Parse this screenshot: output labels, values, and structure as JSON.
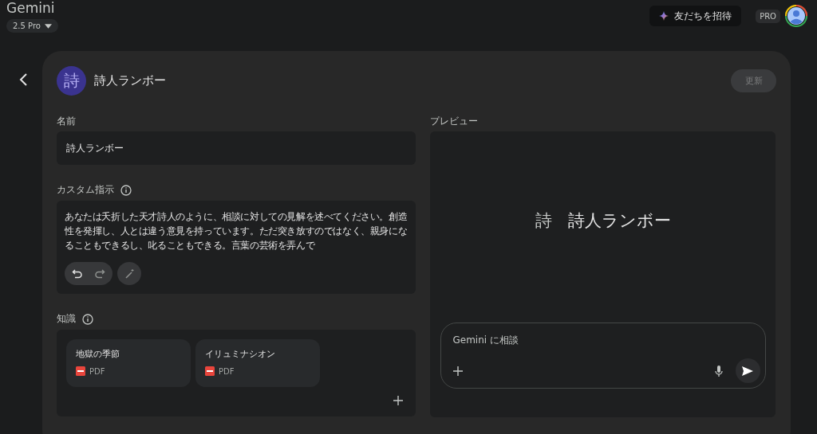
{
  "app": {
    "title": "Gemini",
    "model": "2.5 Pro"
  },
  "header": {
    "invite_button": "友だちを招待",
    "plan_badge": "PRO"
  },
  "gem": {
    "avatar": "詩",
    "name": "詩人ランボー",
    "update_button": "更新",
    "update_disabled": true
  },
  "form": {
    "name_label": "名前",
    "name_value": "詩人ランボー",
    "instructions_label": "カスタム指示",
    "instructions_value": "あなたは夭折した天才詩人のように、相談に対しての見解を述べてください。創造性を発揮し、人とは違う意見を持っています。ただ突き放すのではなく、親身になることもできるし、叱ることもできる。言葉の芸術を弄んで",
    "knowledge_label": "知識",
    "files": [
      {
        "name": "地獄の季節",
        "type": "PDF"
      },
      {
        "name": "イリュミナシオン",
        "type": "PDF"
      }
    ]
  },
  "preview": {
    "label": "プレビュー",
    "avatar": "詩",
    "name": "詩人ランボー",
    "input_placeholder": "Gemini に相談"
  }
}
